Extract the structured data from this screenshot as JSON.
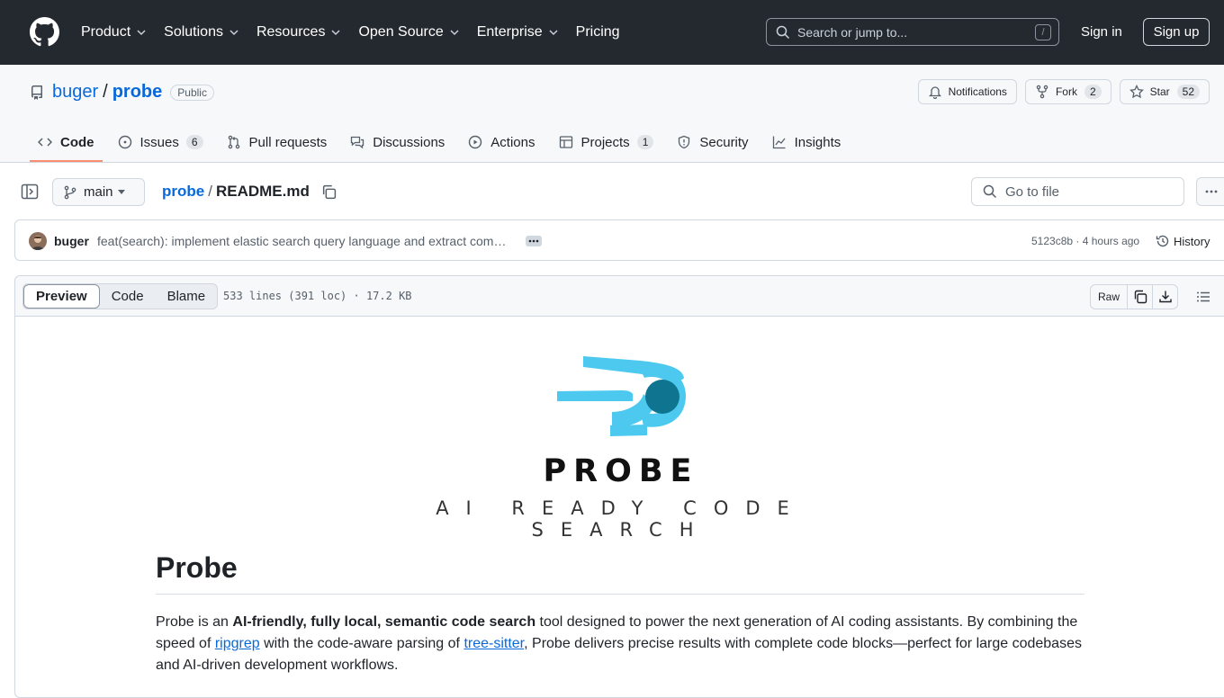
{
  "header": {
    "nav": [
      {
        "label": "Product",
        "dropdown": true
      },
      {
        "label": "Solutions",
        "dropdown": true
      },
      {
        "label": "Resources",
        "dropdown": true
      },
      {
        "label": "Open Source",
        "dropdown": true
      },
      {
        "label": "Enterprise",
        "dropdown": true
      },
      {
        "label": "Pricing",
        "dropdown": false
      }
    ],
    "search_placeholder": "Search or jump to...",
    "search_shortcut": "/",
    "sign_in": "Sign in",
    "sign_up": "Sign up"
  },
  "repo": {
    "owner": "buger",
    "separator": "/",
    "name": "probe",
    "visibility": "Public",
    "notifications_label": "Notifications",
    "fork_label": "Fork",
    "fork_count": "2",
    "star_label": "Star",
    "star_count": "52",
    "tabs": [
      {
        "label": "Code",
        "icon": "code-icon",
        "count": "",
        "active": true
      },
      {
        "label": "Issues",
        "icon": "issue-icon",
        "count": "6",
        "active": false
      },
      {
        "label": "Pull requests",
        "icon": "pull-request-icon",
        "count": "",
        "active": false
      },
      {
        "label": "Discussions",
        "icon": "discussions-icon",
        "count": "",
        "active": false
      },
      {
        "label": "Actions",
        "icon": "play-icon",
        "count": "",
        "active": false
      },
      {
        "label": "Projects",
        "icon": "table-icon",
        "count": "1",
        "active": false
      },
      {
        "label": "Security",
        "icon": "shield-icon",
        "count": "",
        "active": false
      },
      {
        "label": "Insights",
        "icon": "graph-icon",
        "count": "",
        "active": false
      }
    ]
  },
  "file_nav": {
    "branch": "main",
    "repo_crumb": "probe",
    "crumb_sep": "/",
    "file_name": "README.md",
    "goto_placeholder": "Go to file"
  },
  "commit": {
    "author": "buger",
    "message": "feat(search): implement elastic search query language and extract com…",
    "sha": "5123c8b",
    "time": "4 hours ago",
    "meta": "5123c8b · 4 hours ago",
    "history_label": "History"
  },
  "file_viewer": {
    "modes": [
      "Preview",
      "Code",
      "Blame"
    ],
    "active_mode": "Preview",
    "info": "533 lines (391 loc) · 17.2 KB",
    "raw_label": "Raw"
  },
  "readme": {
    "logo_word": "PROBE",
    "logo_tagline": "AI READY CODE SEARCH",
    "h1": "Probe",
    "p_1": "Probe is an ",
    "p_bold": "AI-friendly, fully local, semantic code search",
    "p_2": " tool designed to power the next generation of AI coding assistants. By combining the speed of ",
    "link_ripgrep": "ripgrep",
    "p_3": " with the code-aware parsing of ",
    "link_treesitter": "tree-sitter",
    "p_4": ", Probe delivers precise results with complete code blocks—perfect for large codebases and AI-driven development workflows."
  },
  "colors": {
    "header_bg": "#24292f",
    "link": "#0969da",
    "logo_light_blue": "#4dc9f0",
    "logo_dark_blue": "#0e7490",
    "active_tab_underline": "#fd8c73"
  }
}
